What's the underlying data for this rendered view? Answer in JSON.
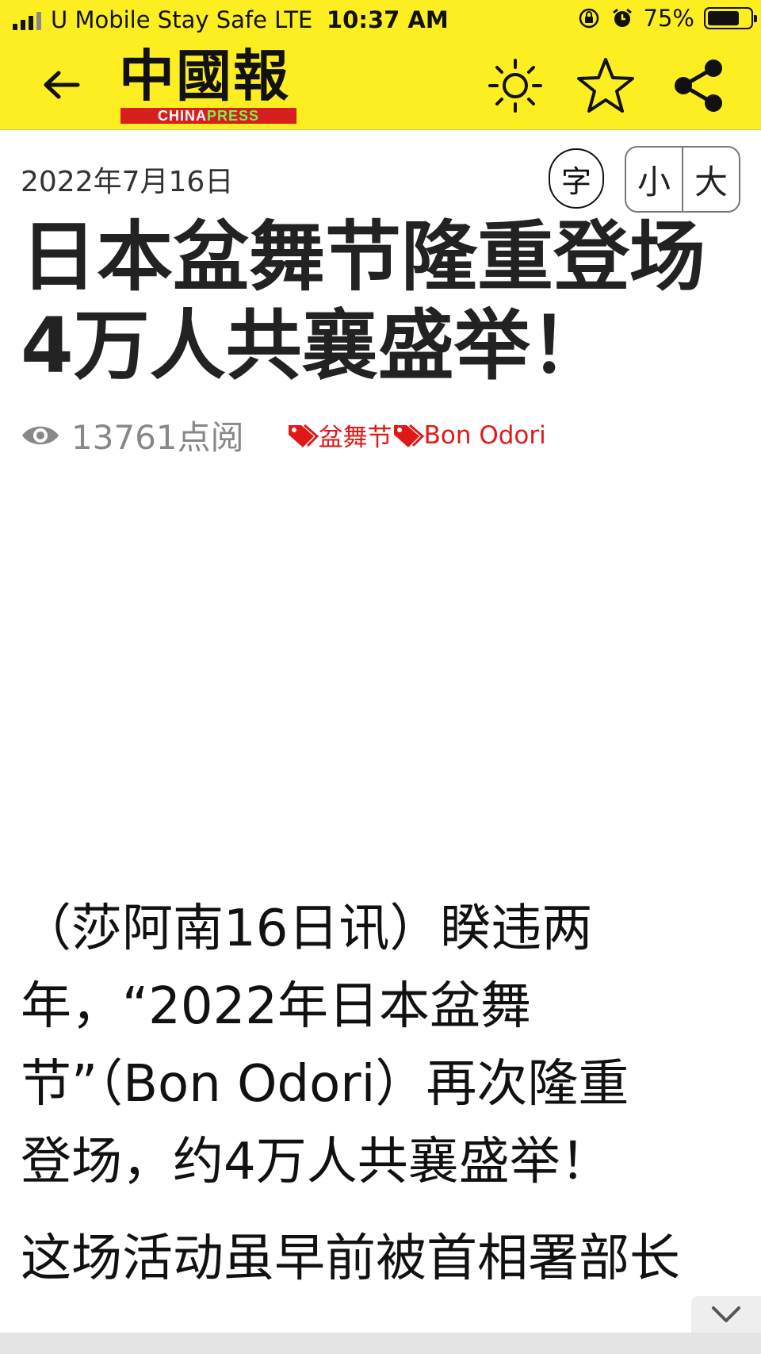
{
  "status_bar": {
    "carrier": "U Mobile Stay Safe  LTE",
    "time": "10:37 AM",
    "battery_text": "75%",
    "battery_level": 0.75
  },
  "header": {
    "logo_text": "中國報",
    "logo_sub_a": "CHINA",
    "logo_sub_b": "PRESS",
    "icons": [
      "back-arrow-icon",
      "brightness-icon",
      "star-icon",
      "share-icon"
    ]
  },
  "article": {
    "date": "2022年7月16日",
    "font_button": "字",
    "size_small": "小",
    "size_large": "大",
    "title_lines": [
      "日本盆舞节隆重登场",
      "4万人共襄盛举！"
    ],
    "views": "13761点阅",
    "tags": [
      "盆舞节",
      "Bon Odori"
    ],
    "paragraph_1_lines": [
      "（莎阿南16日讯）睽违两",
      "年，“2022年日本盆舞",
      "节”（Bon Odori）再次隆重",
      "登场，约4万人共襄盛举！"
    ],
    "paragraph_2": "这场活动虽早前被首相署部长"
  },
  "colors": {
    "header_bg": "#fdee21",
    "tag_red": "#e11818",
    "logo_red": "#d71f1f",
    "logo_green": "#7cf04a"
  }
}
